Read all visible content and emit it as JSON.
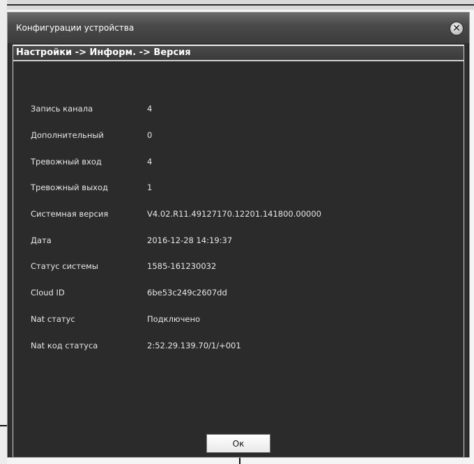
{
  "window": {
    "title": "Конфигурации устройства",
    "close_glyph": "✕"
  },
  "breadcrumb": "Настройки -> Информ. -> Версия",
  "info_rows": [
    {
      "label": "Запись канала",
      "value": "4"
    },
    {
      "label": "Дополнительный",
      "value": "0"
    },
    {
      "label": "Тревожный вход",
      "value": "4"
    },
    {
      "label": "Тревожный выход",
      "value": "1"
    },
    {
      "label": "Системная версия",
      "value": "V4.02.R11.49127170.12201.141800.00000"
    },
    {
      "label": "Дата",
      "value": "2016-12-28 14:19:37"
    },
    {
      "label": "Статус системы",
      "value": "1585-161230032"
    },
    {
      "label": "Cloud ID",
      "value": " 6be53c249c2607dd"
    },
    {
      "label": "Nat статус",
      "value": "Подключено"
    },
    {
      "label": "Nat код статуса",
      "value": "2:52.29.139.70/1/+001"
    }
  ],
  "buttons": {
    "ok": "Ок"
  },
  "colors": {
    "panel_background": "#2e2e2e",
    "text": "#e6e6e6"
  }
}
